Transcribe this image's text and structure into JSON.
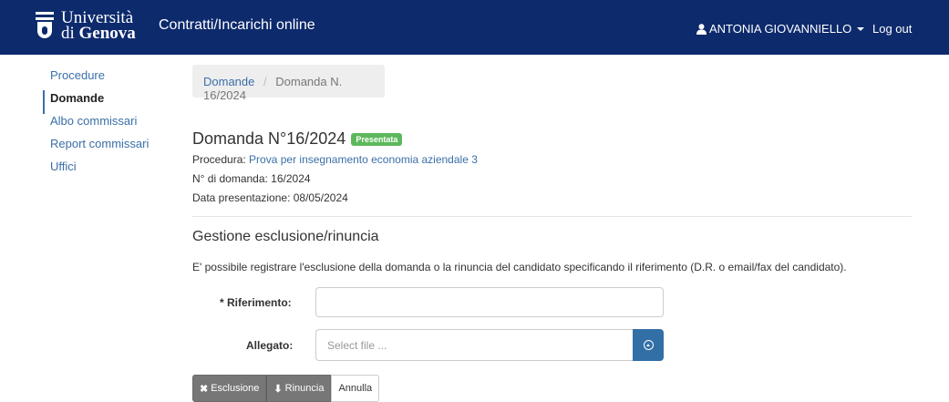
{
  "header": {
    "logo_line1": "Università",
    "logo_line2_prefix": "di ",
    "logo_line2_bold": "Genova",
    "app_title": "Contratti/Incarichi online",
    "user_icon": "user-icon",
    "user_name": "ANTONIA GIOVANNIELLO",
    "logout_label": "Log out"
  },
  "sidebar": {
    "items": [
      {
        "label": "Procedure"
      },
      {
        "label": "Domande"
      },
      {
        "label": "Albo commissari"
      },
      {
        "label": "Report commissari"
      },
      {
        "label": "Uffici"
      }
    ]
  },
  "breadcrumb": {
    "link": "Domande",
    "separator": "/",
    "current": "Domanda N. 16/2024"
  },
  "domanda": {
    "title": "Domanda N°16/2024",
    "status": "Presentata",
    "procedura_label": "Procedura:",
    "procedura_link": "Prova per insegnamento economia aziendale 3",
    "numero": "N° di domanda: 16/2024",
    "data_presentazione": "Data presentazione: 08/05/2024"
  },
  "gestione": {
    "title": "Gestione esclusione/rinuncia",
    "description": "E' possibile registrare l'esclusione della domanda o la rinuncia del candidato specificando il riferimento (D.R. o email/fax del candidato).",
    "riferimento_label": "* Riferimento:",
    "riferimento_value": "",
    "allegato_label": "Allegato:",
    "allegato_placeholder": "Select file ...",
    "upload_icon": "upload-circle-icon"
  },
  "actions": {
    "esclusione_icon": "✖",
    "esclusione_label": "Esclusione",
    "rinuncia_icon": "⬇",
    "rinuncia_label": "Rinuncia",
    "annulla_label": "Annulla"
  },
  "colors": {
    "navbar": "#0d2a6c",
    "link": "#3a6fa8",
    "badge_success": "#5cb85c",
    "primary_button": "#336fa7",
    "dark_button": "#777777"
  }
}
